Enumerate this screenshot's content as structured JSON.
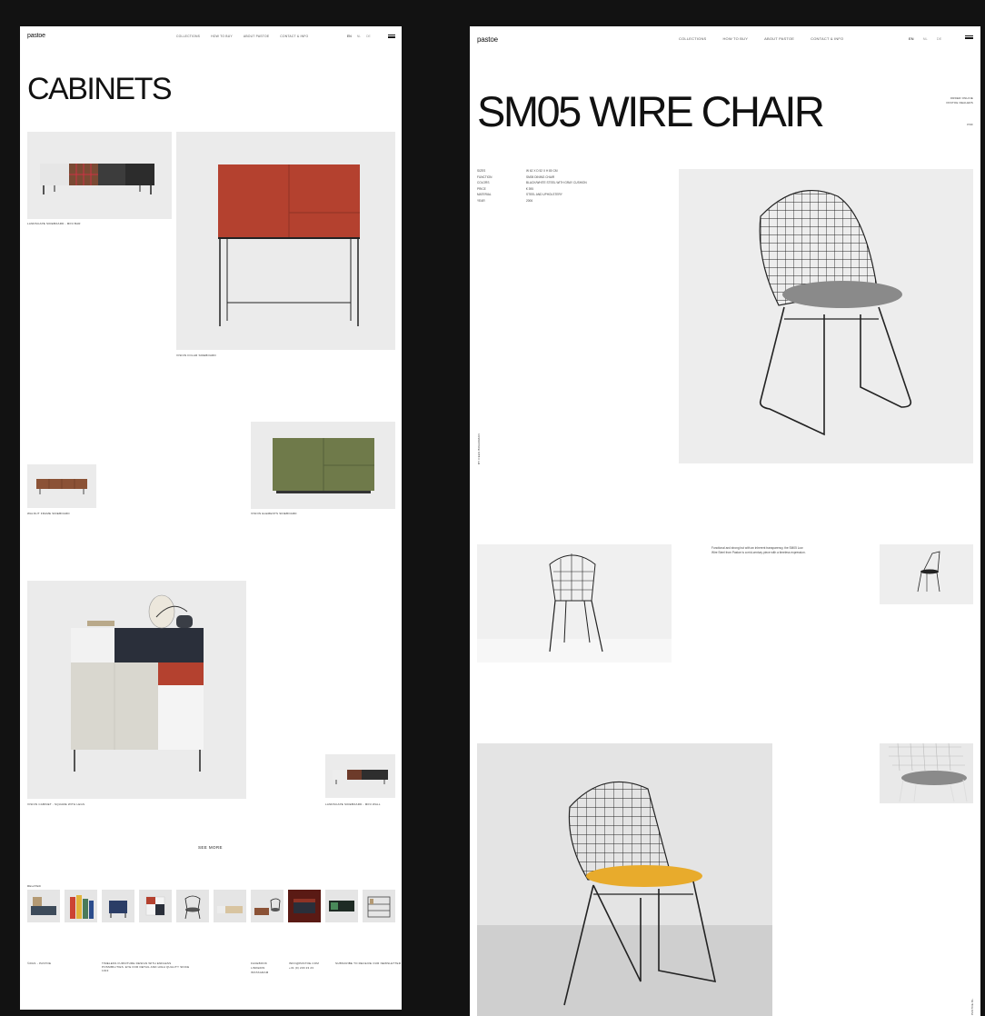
{
  "pastoe_brand": "pastoe",
  "nav": [
    "COLLECTIONS",
    "HOW TO BUY",
    "ABOUT PASTOE",
    "CONTACT & INFO"
  ],
  "languages": [
    "EN",
    "NL",
    "DE"
  ],
  "page1": {
    "title": "CABINETS",
    "captions": {
      "landscape1": "LANDSCAPE SIDEBOARD - MINI BAR",
      "vision_tall": "VISION FOLAR SIDEBOARD",
      "walnut": "WALNUT FRAME SIDEBOARD",
      "green": "VISION ELEMENTS SIDEBOARD",
      "vision_square": "VISION CABINET - SQUARE WITH LEGS",
      "landscape2": "LANDSCAPE SIDEBOARD - MINI WALL"
    },
    "see_more": "SEE MORE",
    "related_label": "RELATED",
    "footer": {
      "copyright": "©2021 - PASTOE",
      "tagline": "TIMELESS FURNITURE DESIGN WITH ENDLESS POSSIBILITIES. EYE FOR DETAIL AND HIGH QUALITY SINCE 1913",
      "social": [
        "FACEBOOK",
        "LINKEDIN",
        "INSTAGRAM"
      ],
      "contact": [
        "INFO@PASTOE.COM",
        "+31 (0) 230 23 23"
      ],
      "newsletter": "SUBSCRIBE TO RECEIVE OUR NEWSLETTER"
    }
  },
  "page2": {
    "title": "SM05 WIRE CHAIR",
    "order_online": "ORDER ONLINE",
    "pastoe_dealers": "PASTOE DEALERS",
    "pdf": "PDF",
    "specs": [
      {
        "label": "SIZES",
        "value": "W 62 X D 52 X H 80 CM"
      },
      {
        "label": "FUNCTION",
        "value": "SM05 DINING CHAIR"
      },
      {
        "label": "COLORS",
        "value": "BLACK/WHITE STEEL WITH GRAY CUSHION"
      },
      {
        "label": "PRICE",
        "value": "€ 395"
      },
      {
        "label": "MATERIAL",
        "value": "STEEL AND UPHOLSTERY"
      },
      {
        "label": "YEAR",
        "value": "2006"
      }
    ],
    "designer": "BY CEES BRAAKMAN",
    "description": "Functional and strong but with an inherent transparency, the SM05 Low Wire Steel from Pastoe is a mid-century piece with a timeless expression.",
    "vertical_right": "PASTOE.NL"
  },
  "colors": {
    "background": "#121212",
    "rust": "#b4412f",
    "olive": "#6f7a4a",
    "navy": "#2a2f3a",
    "cushion_gray": "#8a8a8a",
    "cushion_yellow": "#e8ab2c"
  }
}
